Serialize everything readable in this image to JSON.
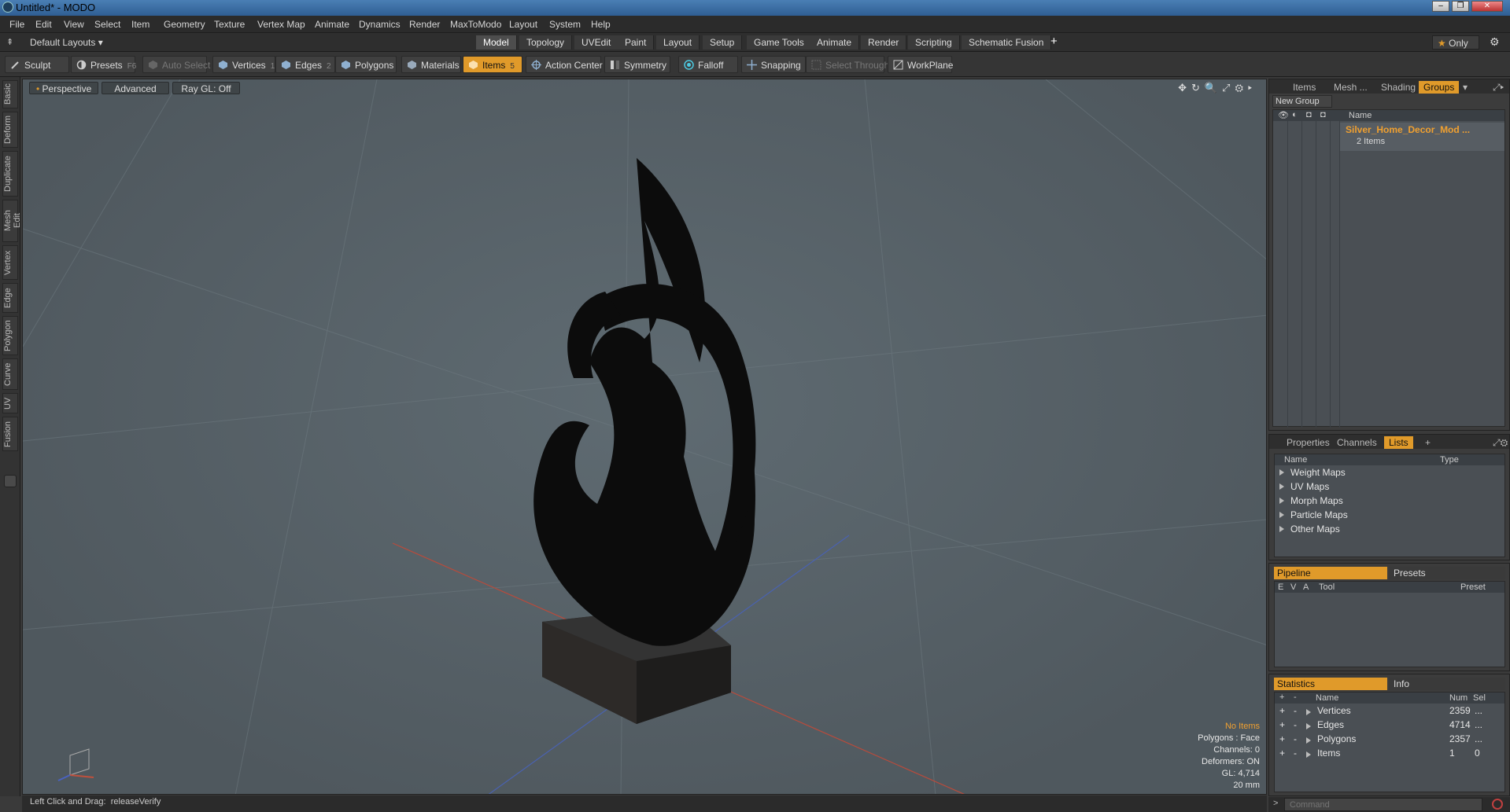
{
  "window": {
    "title": "Untitled* - MODO"
  },
  "menubar": [
    "File",
    "Edit",
    "View",
    "Select",
    "Item",
    "Geometry",
    "Texture",
    "Vertex Map",
    "Animate",
    "Dynamics",
    "Render",
    "MaxToModo",
    "Layout",
    "System",
    "Help"
  ],
  "layoutbar": {
    "layout_selector": "Default Layouts",
    "tabs": [
      "Model",
      "Topology",
      "UVEdit",
      "Paint",
      "Layout",
      "Setup",
      "Game Tools",
      "Animate",
      "Render",
      "Scripting",
      "Schematic Fusion"
    ],
    "active_tab": "Model",
    "add": "+",
    "only": "Only"
  },
  "toolbar": {
    "sculpt": "Sculpt",
    "presets": "Presets",
    "presets_key": "F6",
    "auto_select": "Auto Select",
    "vertices": "Vertices",
    "vertices_key": "1",
    "edges": "Edges",
    "edges_key": "2",
    "polygons": "Polygons",
    "materials": "Materials",
    "items": "Items",
    "items_key": "5",
    "action_center": "Action Center",
    "symmetry": "Symmetry",
    "falloff": "Falloff",
    "snapping": "Snapping",
    "select_through": "Select Through",
    "workplane": "WorkPlane"
  },
  "left_tabs": [
    "Basic",
    "Deform",
    "Duplicate",
    "Mesh Edit",
    "Vertex",
    "Edge",
    "Polygon",
    "Curve",
    "UV",
    "Fusion"
  ],
  "viewport": {
    "view": "Perspective",
    "mode": "Advanced",
    "raygl": "Ray GL: Off",
    "info": {
      "no_items": "No Items",
      "polygons": "Polygons : Face",
      "channels": "Channels: 0",
      "deformers": "Deformers: ON",
      "gl": "GL: 4,714",
      "scale": "20 mm"
    }
  },
  "status": {
    "hint": "Left Click and Drag:",
    "action": "releaseVerify"
  },
  "groups_panel": {
    "tabs": [
      "Items",
      "Mesh ...",
      "Shading",
      "Groups"
    ],
    "active_tab": "Groups",
    "new_group": "New Group",
    "col_name": "Name",
    "group_name": "Silver_Home_Decor_Mod ...",
    "group_count": "2 Items"
  },
  "lists_panel": {
    "tabs": [
      "Properties",
      "Channels",
      "Lists"
    ],
    "active_tab": "Lists",
    "add": "+",
    "col_name": "Name",
    "col_type": "Type",
    "items": [
      "Weight Maps",
      "UV Maps",
      "Morph Maps",
      "Particle Maps",
      "Other Maps"
    ]
  },
  "pipeline_panel": {
    "tabs": [
      "Pipeline",
      "Presets"
    ],
    "cols": [
      "E",
      "V",
      "A",
      "Tool",
      "Preset"
    ]
  },
  "stats_panel": {
    "tabs": [
      "Statistics",
      "Info"
    ],
    "col_name": "Name",
    "col_num": "Num",
    "col_sel": "Sel",
    "rows": [
      {
        "name": "Vertices",
        "num": "2359",
        "sel": "..."
      },
      {
        "name": "Edges",
        "num": "4714",
        "sel": "..."
      },
      {
        "name": "Polygons",
        "num": "2357",
        "sel": "..."
      },
      {
        "name": "Items",
        "num": "1",
        "sel": "0"
      }
    ]
  },
  "command": {
    "placeholder": "Command"
  },
  "colors": {
    "accent": "#e09a2a",
    "viewport_bg": "#5a646a",
    "name_orange": "#f0a030"
  }
}
